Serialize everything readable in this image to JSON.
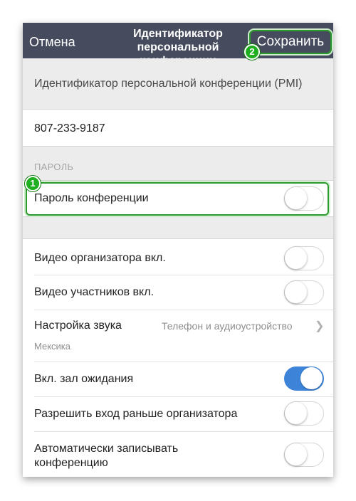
{
  "topbar": {
    "cancel_label": "Отмена",
    "title": "Идентификатор персональной конференции",
    "save_label": "Сохранить"
  },
  "badges": {
    "one": "1",
    "two": "2"
  },
  "pmi": {
    "label": "Идентификатор персональной конференции (PMI)",
    "value": "807-233-9187"
  },
  "password": {
    "section_header": "ПАРОЛЬ",
    "meeting_password_label": "Пароль конференции",
    "meeting_password_on": false
  },
  "settings": {
    "host_video": {
      "label": "Видео организатора вкл.",
      "on": false
    },
    "participant_video": {
      "label": "Видео участников вкл.",
      "on": false
    },
    "audio": {
      "label": "Настройка звука",
      "value": "Телефон и аудиоустройство",
      "sublabel": "Мексика"
    },
    "waiting_room": {
      "label": "Вкл. зал ожидания",
      "on": true
    },
    "join_before_host": {
      "label": "Разрешить вход раньше организатора",
      "on": false
    },
    "auto_record": {
      "label": "Автоматически записывать конференцию",
      "on": false
    }
  },
  "colors": {
    "topbar": "#464c5e",
    "accent_blue": "#3d84d9",
    "highlight_green": "#2c9a2c"
  }
}
